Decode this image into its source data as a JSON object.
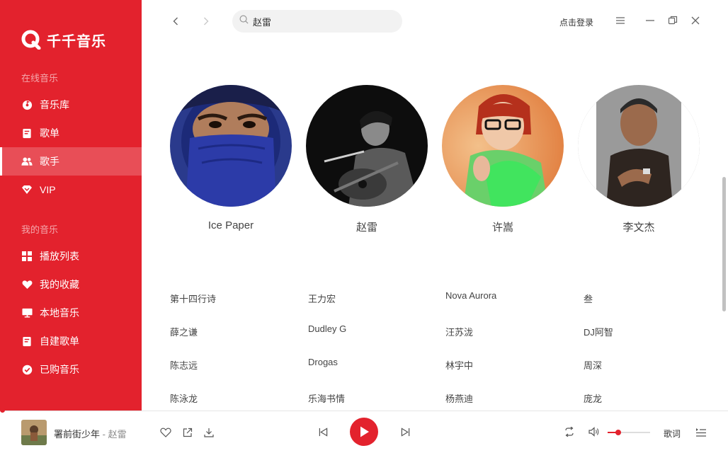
{
  "app": {
    "name": "千千音乐",
    "brand_color": "#e3222d"
  },
  "sidebar": {
    "sections": [
      {
        "title": "在线音乐",
        "items": [
          {
            "label": "音乐库",
            "icon": "disc-icon"
          },
          {
            "label": "歌单",
            "icon": "playlist-icon"
          },
          {
            "label": "歌手",
            "icon": "singer-icon",
            "active": true
          },
          {
            "label": "VIP",
            "icon": "vip-icon"
          }
        ]
      },
      {
        "title": "我的音乐",
        "items": [
          {
            "label": "播放列表",
            "icon": "grid-icon"
          },
          {
            "label": "我的收藏",
            "icon": "heart-icon"
          },
          {
            "label": "本地音乐",
            "icon": "monitor-icon"
          },
          {
            "label": "自建歌单",
            "icon": "document-icon"
          },
          {
            "label": "已购音乐",
            "icon": "check-circle-icon"
          }
        ]
      }
    ]
  },
  "topbar": {
    "search_value": "赵雷",
    "login_label": "点击登录"
  },
  "artists": [
    {
      "name": "Ice Paper"
    },
    {
      "name": "赵雷"
    },
    {
      "name": "许嵩"
    },
    {
      "name": "李文杰"
    }
  ],
  "artist_names": [
    [
      "第十四行诗",
      "王力宏",
      "Nova Aurora",
      "叁"
    ],
    [
      "薛之谦",
      "Dudley G",
      "汪苏泷",
      "DJ阿智"
    ],
    [
      "陈志远",
      "Drogas",
      "林宇中",
      "周深"
    ],
    [
      "陈泳龙",
      "乐海书情",
      "杨燕迪",
      "庞龙"
    ]
  ],
  "player": {
    "song_title": "署前街少年",
    "separator": " - ",
    "song_artist": "赵雷",
    "lyric_label": "歌词",
    "volume": 0.25
  }
}
